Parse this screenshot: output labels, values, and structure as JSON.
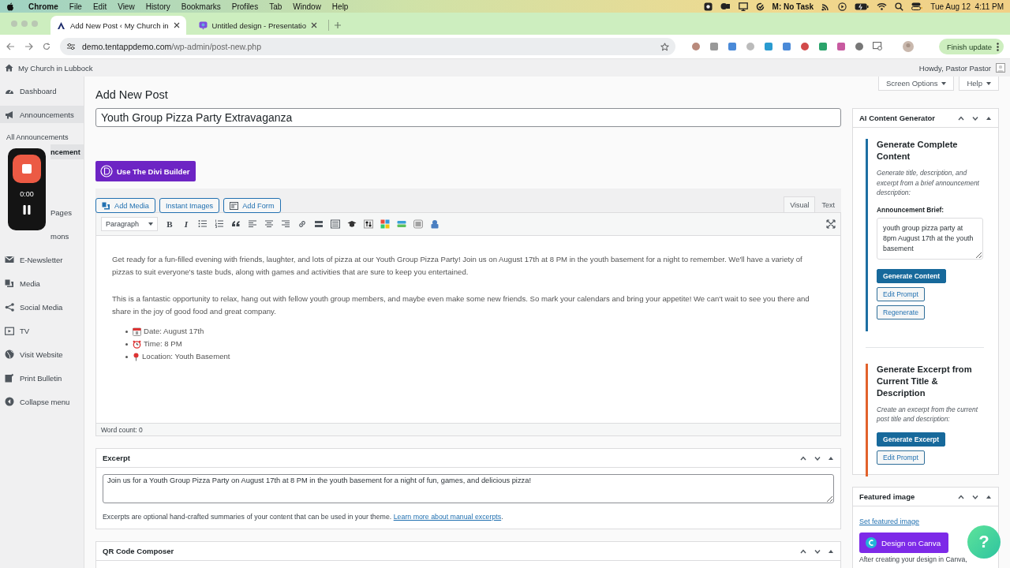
{
  "menubar": {
    "app": "Chrome",
    "menus": [
      "File",
      "Edit",
      "View",
      "History",
      "Bookmarks",
      "Profiles",
      "Tab",
      "Window",
      "Help"
    ],
    "task": "M: No Task",
    "clock": "Tue Aug 12  4:11 PM"
  },
  "browser": {
    "tabs": [
      {
        "title": "Add New Post ‹ My Church in",
        "selected": true
      },
      {
        "title": "Untitled design - Presentatio",
        "selected": false
      }
    ],
    "url": "demo.tentappdemo.com/wp-admin/post-new.php",
    "update_button": "Finish update"
  },
  "admin_bar": {
    "site": "My Church in Lubbock",
    "greeting": "Howdy, Pastor Pastor"
  },
  "sidebar": {
    "items": [
      {
        "label": "Dashboard",
        "kind": "menu",
        "selected": false
      },
      {
        "label": "Announcements",
        "kind": "menu",
        "selected": true
      },
      {
        "label": "All Announcements",
        "kind": "sub",
        "selected": false
      },
      {
        "label": "ncement",
        "kind": "covered-sub",
        "selected": true
      },
      {
        "label": "Pages",
        "kind": "covered",
        "selected": false
      },
      {
        "label": "mons",
        "kind": "covered",
        "selected": false
      },
      {
        "label": "E-Newsletter",
        "kind": "menu",
        "selected": false
      },
      {
        "label": "Media",
        "kind": "menu",
        "selected": false
      },
      {
        "label": "Social Media",
        "kind": "menu",
        "selected": false
      },
      {
        "label": "TV",
        "kind": "menu",
        "selected": false
      },
      {
        "label": "Visit Website",
        "kind": "menu",
        "selected": false
      },
      {
        "label": "Print Bulletin",
        "kind": "menu",
        "selected": false
      },
      {
        "label": "Collapse menu",
        "kind": "menu",
        "selected": false
      }
    ]
  },
  "recorder": {
    "time": "0:00"
  },
  "page": {
    "heading": "Add New Post",
    "screen_options": "Screen Options",
    "help": "Help"
  },
  "post_title": "Youth Group Pizza Party Extravaganza",
  "divi_button": "Use The Divi Builder",
  "editor": {
    "media_buttons": [
      "Add Media",
      "Instant Images",
      "Add Form"
    ],
    "tabs": [
      {
        "label": "Visual",
        "selected": true
      },
      {
        "label": "Text",
        "selected": false
      }
    ],
    "format": "Paragraph",
    "format_buttons": [
      "B",
      "I"
    ],
    "paragraphs": [
      "Get ready for a fun-filled evening with friends, laughter, and lots of pizza at our Youth Group Pizza Party! Join us on August 17th at 8 PM in the youth basement for a night to remember. We'll have a variety of pizzas to suit everyone's taste buds, along with games and activities that are sure to keep you entertained.",
      "This is a fantastic opportunity to relax, hang out with fellow youth group members, and maybe even make some new friends. So mark your calendars and bring your appetite! We can't wait to see you there and share in the joy of good food and great company."
    ],
    "list": [
      {
        "kind": "calendar",
        "text": "Date: August 17th"
      },
      {
        "kind": "clock",
        "text": "Time: 8 PM"
      },
      {
        "kind": "pin",
        "text": "Location: Youth Basement"
      }
    ],
    "word_count": "Word count: 0"
  },
  "excerpt": {
    "title": "Excerpt",
    "value": "Join us for a Youth Group Pizza Party on August 17th at 8 PM in the youth basement for a night of fun, games, and delicious pizza!",
    "help": "Excerpts are optional hand-crafted summaries of your content that can be used in your theme.",
    "link": "Learn more about manual excerpts",
    "help_end": "."
  },
  "qr": {
    "title": "QR Code Composer"
  },
  "ai": {
    "title": "AI Content Generator",
    "sections": [
      {
        "title": "Generate Complete Content",
        "color": "#1d6fa3",
        "description": "Generate title, description, and excerpt from a brief announcement description:",
        "field_label": "Announcement Brief:",
        "field_value": "youth group pizza party at 8pm August 17th at the youth basement",
        "buttons": [
          {
            "label": "Generate Content",
            "kind": "primary"
          },
          {
            "label": "Edit Prompt",
            "kind": "secondary"
          },
          {
            "label": "Regenerate",
            "kind": "secondary"
          }
        ]
      },
      {
        "title": "Generate Excerpt from Current Title & Description",
        "color": "#e2622c",
        "description": "Create an excerpt from the current post title and description:",
        "buttons": [
          {
            "label": "Generate Excerpt",
            "kind": "primary"
          },
          {
            "label": "Edit Prompt",
            "kind": "secondary"
          }
        ]
      }
    ]
  },
  "featured": {
    "title": "Featured image",
    "link": "Set featured image",
    "canva_button": "Design on Canva",
    "note": "After creating your design in Canva,"
  },
  "help_bubble": "?"
}
